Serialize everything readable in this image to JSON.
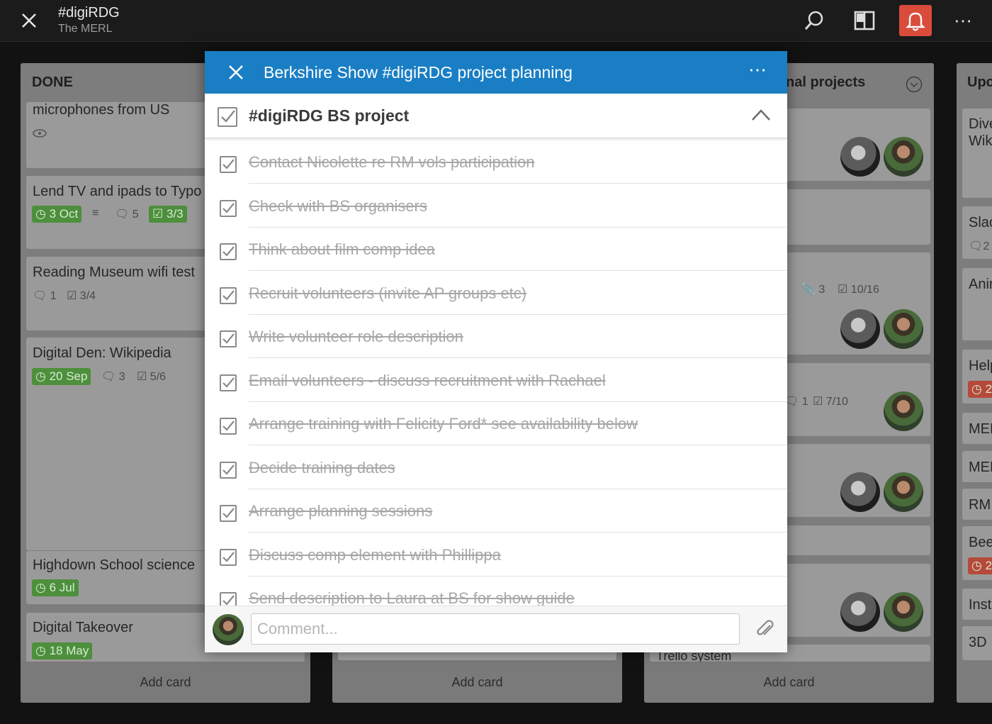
{
  "topbar": {
    "title": "#digiRDG",
    "subtitle": "The MERL"
  },
  "lists": [
    {
      "name": "DONE",
      "add_card": "Add card",
      "cards": [
        {
          "title": "microphones from US"
        },
        {
          "title": "Lend TV and ipads to Typo",
          "due": "3 Oct",
          "comments": "5",
          "checklist": "3/3"
        },
        {
          "title": "Reading Museum wifi test",
          "comments": "1",
          "checklist": "3/4"
        },
        {
          "title": "Digital Den: Wikipedia",
          "due": "20 Sep",
          "comments": "3",
          "checklist": "5/6"
        },
        {
          "title": "Highdown School science",
          "due": "6 Jul"
        },
        {
          "title": "Digital Takeover",
          "due": "18 May"
        }
      ]
    },
    {
      "name": "",
      "add_card": "Add card"
    },
    {
      "name": "nal projects",
      "add_card": "Add card",
      "cards": [
        {
          "attachments": "3",
          "checklist": "10/16"
        },
        {
          "comments": "1",
          "checklist": "7/10"
        },
        {
          "title": "Trello system"
        }
      ]
    },
    {
      "name": "Upc",
      "cards": [
        "Dive Wik",
        "Slac",
        "Anir",
        "Help",
        "MER",
        "MER",
        "RM",
        "Bee",
        "Inst",
        "3D"
      ],
      "badges": [
        "2",
        "2",
        "2"
      ]
    }
  ],
  "modal": {
    "title": "Berkshire Show #digiRDG project planning",
    "checklist_title": "#digiRDG BS project",
    "items": [
      "Contact Nicolette re RM vols participation",
      "Check with BS organisers",
      "Think about film comp idea",
      "Recruit volunteers (invite AP groups etc)",
      "Write volunteer role description",
      "Email volunteers - discuss recruitment with Rachael",
      "Arrange training with Felicity Ford* see availability below",
      "Decide training dates",
      "Arrange planning sessions",
      "Discuss comp element with Phillippa",
      "Send description to Laura at BS for show guide"
    ],
    "comment_placeholder": "Comment..."
  },
  "icons": {
    "close": "close-icon",
    "search": "search-icon",
    "board": "board-icon",
    "bell": "bell-icon",
    "more": "more-icon",
    "eye": "eye-icon",
    "clock": "clock-icon",
    "comment": "comment-icon",
    "checklist": "checklist-icon",
    "attachment": "attachment-icon",
    "chevron": "chevron-up-icon",
    "description": "description-icon"
  },
  "colors": {
    "accent": "#1a7ec4",
    "badge_green": "#4d8f3c",
    "badge_red": "#b54a3b",
    "bell_bg": "#d94c3c"
  }
}
